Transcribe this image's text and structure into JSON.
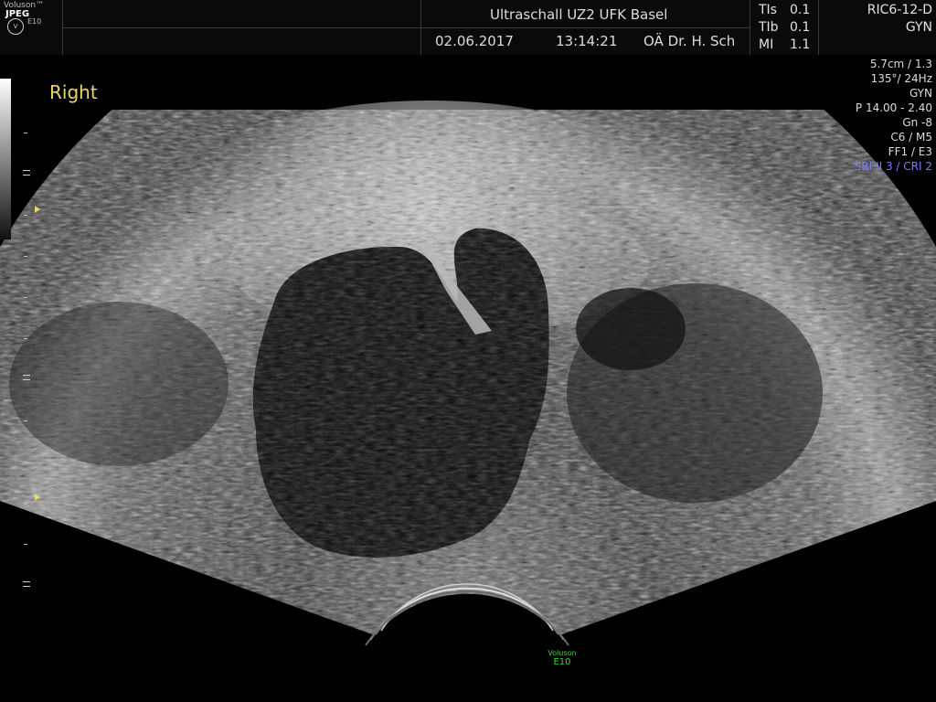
{
  "header": {
    "logo_brand": "Voluson™",
    "logo_badge": "JPEG",
    "logo_model": "E10",
    "institution": "Ultraschall UZ2 UFK Basel",
    "date": "02.06.2017",
    "time": "13:14:21",
    "operator": "OÄ Dr. H. Sch",
    "tis_label": "TIs",
    "tis_value": "0.1",
    "tib_label": "TIb",
    "tib_value": "0.1",
    "mi_label": "MI",
    "mi_value": "1.1",
    "probe": "RIC6-12-D",
    "preset": "GYN"
  },
  "params": {
    "depth": "5.7cm / 1.3",
    "angle_rate": "135°/ 24Hz",
    "application": "GYN",
    "power": "P 14.00 - 2.40",
    "gain": "Gn  -8",
    "chroma": "C6 / M5",
    "filter": "FF1 / E3",
    "sri": "SRI II 3 / CRI 2"
  },
  "orientation_label": "Right",
  "bottom_logo": {
    "brand": "Voluson",
    "model": "E10"
  },
  "colors": {
    "orientation": "#e8d868",
    "sri": "#7b7bff",
    "logo_green": "#38d438",
    "focus_marker": "#e8d868"
  }
}
